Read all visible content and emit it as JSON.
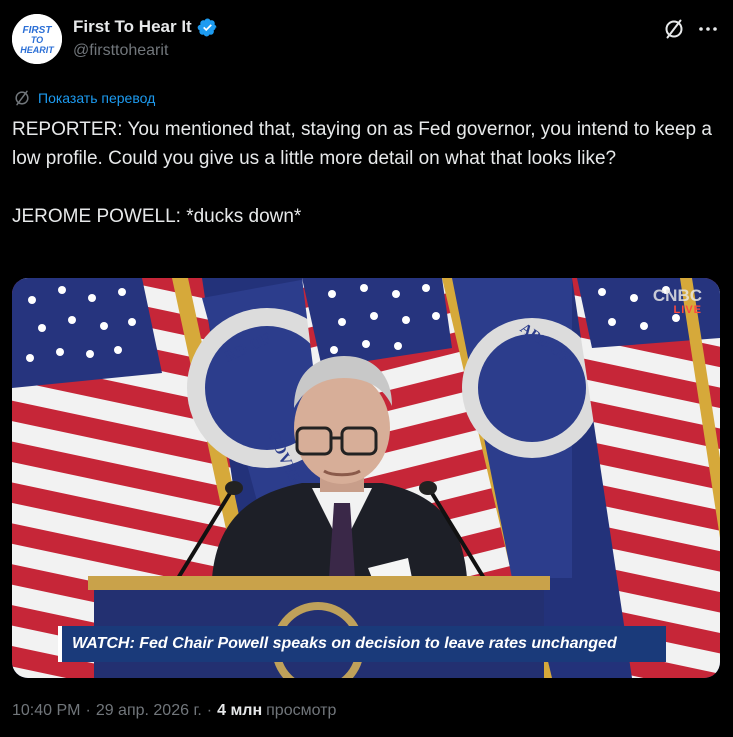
{
  "author": {
    "name": "First To Hear It",
    "handle": "@firsttohearit",
    "avatar_text": "FIRST TO HEAR IT",
    "verified": true
  },
  "header": {
    "grok_icon": "grok-icon",
    "more_icon": "more-dots-icon"
  },
  "translate": {
    "label": "Показать перевод",
    "icon": "translate-icon"
  },
  "tweet": {
    "paragraphs": [
      "REPORTER: You mentioned that, staying on as Fed governor, you intend to keep a low profile. Could you give us a little more detail on what that looks like?",
      "JEROME POWELL: *ducks down*"
    ]
  },
  "media": {
    "network_name": "CNBC",
    "network_badge": "LIVE",
    "chyron": "WATCH: Fed Chair Powell speaks on decision to leave rates unchanged",
    "seal_text": "BOARD OF GOVERNORS"
  },
  "meta": {
    "time": "10:40 PM",
    "separator": "·",
    "date": "29 апр. 2026 г.",
    "views_count": "4 млн",
    "views_label": "просмотр"
  },
  "colors": {
    "background": "#000000",
    "text_primary": "#e7e9ea",
    "text_secondary": "#71767b",
    "link_blue": "#1d9bf0",
    "verified_blue": "#1d9bf0"
  }
}
